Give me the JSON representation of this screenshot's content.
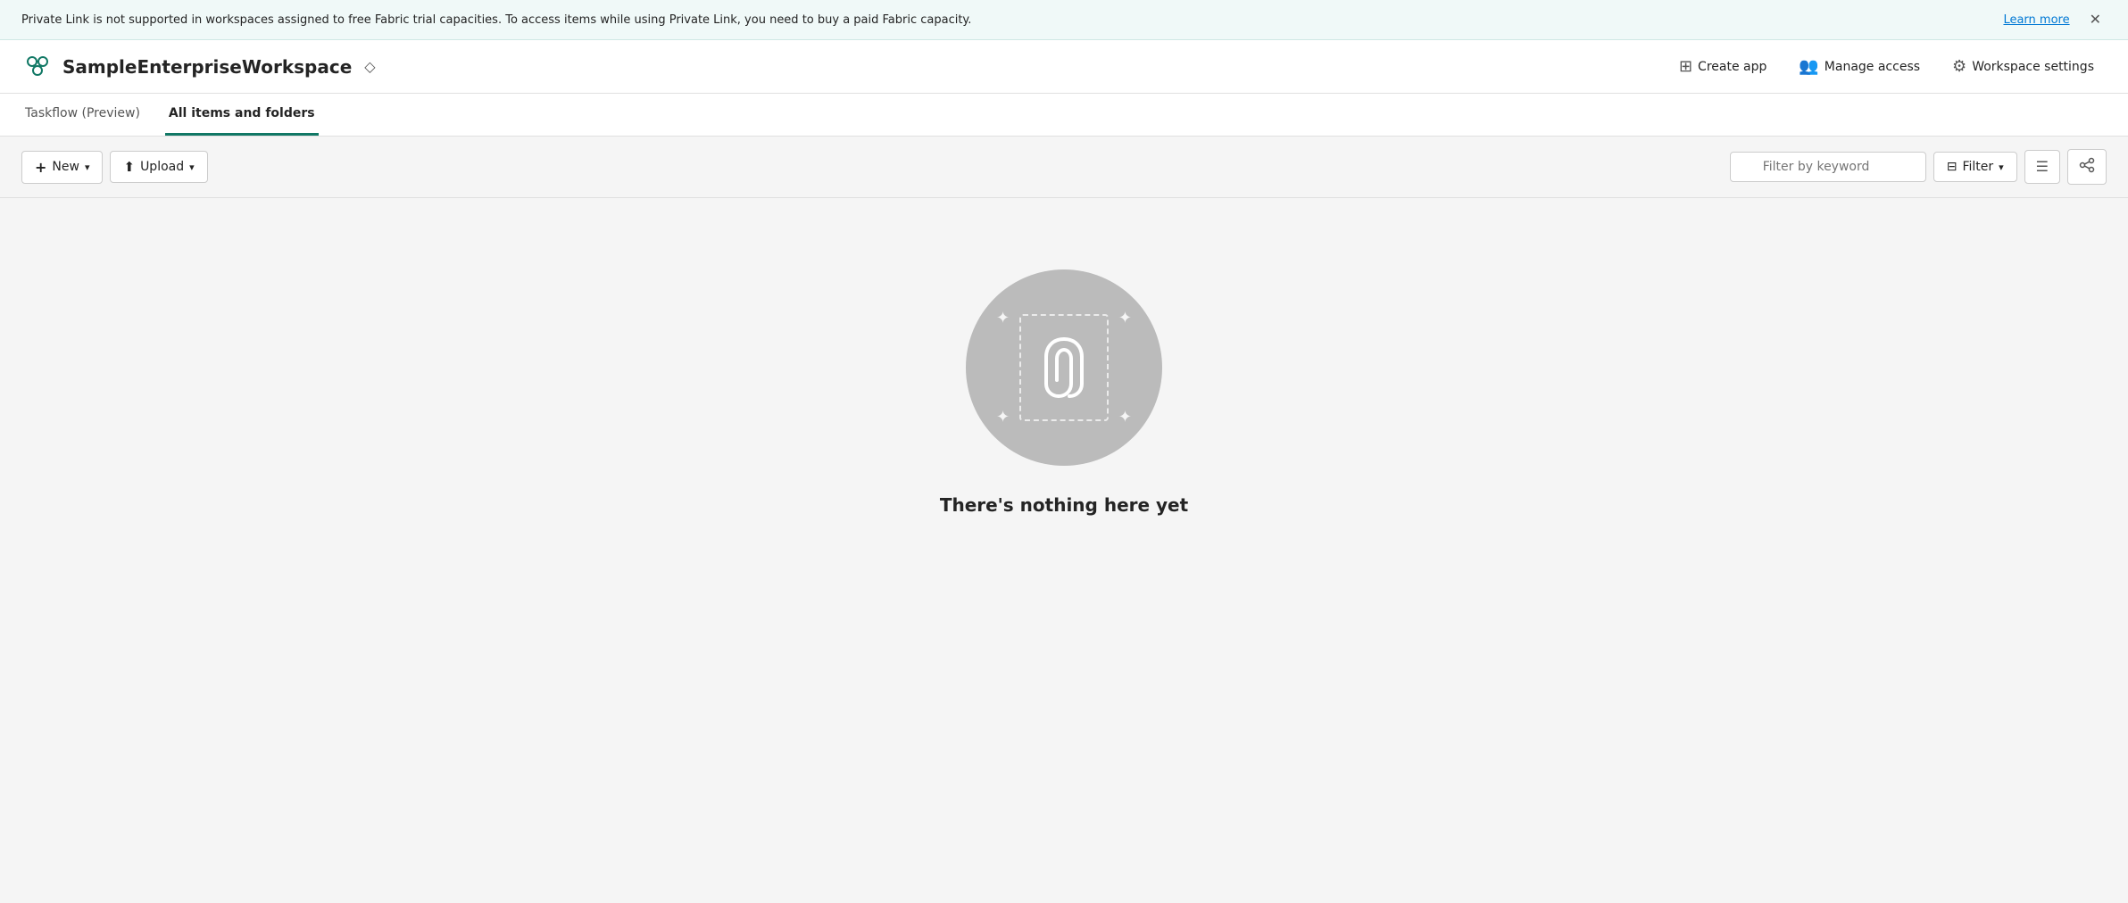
{
  "banner": {
    "message": "Private Link is not supported in workspaces assigned to free Fabric trial capacities. To access items while using Private Link, you need to buy a paid Fabric capacity.",
    "learn_more": "Learn more",
    "close_label": "✕"
  },
  "header": {
    "workspace_name": "SampleEnterpriseWorkspace",
    "diamond_icon": "◇",
    "create_app_label": "Create app",
    "manage_access_label": "Manage access",
    "workspace_settings_label": "Workspace settings"
  },
  "tabs": [
    {
      "id": "taskflow",
      "label": "Taskflow (Preview)",
      "active": false
    },
    {
      "id": "all-items",
      "label": "All items and folders",
      "active": true
    }
  ],
  "toolbar": {
    "new_label": "New",
    "upload_label": "Upload",
    "filter_placeholder": "Filter by keyword",
    "filter_label": "Filter"
  },
  "empty_state": {
    "title": "There's nothing here yet"
  }
}
